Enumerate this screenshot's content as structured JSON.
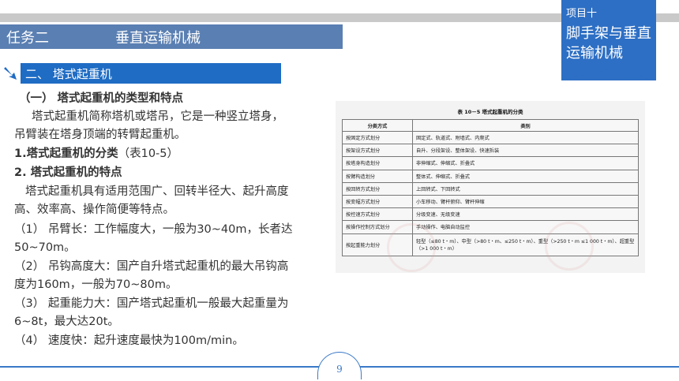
{
  "header": {
    "task": "任务二",
    "task_title": "垂直运输机械",
    "project_no": "项目十",
    "project_name": "脚手架与垂直运输机械"
  },
  "section": {
    "title": "二、 塔式起重机"
  },
  "body": {
    "heading1": "（一） 塔式起重机的类型和特点",
    "p1_line1": "塔式起重机简称塔机或塔吊，它是一种竖立塔身，",
    "p1_line2": "吊臂装在塔身顶端的转臂起重机。",
    "h_class": "1.塔式起重机的分类",
    "h_class_ref": "（表10-5）",
    "h_feat": "2. 塔式起重机的特点",
    "p2_line1": "塔式起重机具有适用范围广、回转半径大、起升高度",
    "p2_line2": "高、效率高、操作简便等特点。",
    "i1_line1": "（1） 吊臂长：工作幅度大，一般为30~40m，长者达",
    "i1_line2": "50~70m。",
    "i2_line1": "（2） 吊钩高度大：国产自升塔式起重机的最大吊钩高",
    "i2_line2": "度为160m，一般为70~80m。",
    "i3_line1": "（3） 起重能力大：国产塔式起重机一般最大起重量为",
    "i3_line2": "6~8t，最大达20t。",
    "i4_line1": "（4） 速度快：起升速度最快为100m/min。"
  },
  "table": {
    "caption": "表 10－5   塔式起重机的分类",
    "headers": [
      "分类方式",
      "类别"
    ],
    "rows": [
      [
        "按固定方式划分",
        "固定式、轨道式、附墙式、内爬式"
      ],
      [
        "按架设方式划分",
        "自升、分段架设、整体架设、快速拆装"
      ],
      [
        "按塔身构造划分",
        "非伸缩式、伸缩式、折叠式"
      ],
      [
        "按臂构造划分",
        "整体式、伸缩式、折叠式"
      ],
      [
        "按回转方式划分",
        "上回转式、下回转式"
      ],
      [
        "按变幅方式划分",
        "小车移动、臂杆俯仰、臂杆伸缩"
      ],
      [
        "按控速方式划分",
        "分级变速、无级变速"
      ],
      [
        "按操作控制方式划分",
        "手动操作、电脑自动监控"
      ],
      [
        "按起重能力划分",
        "轻型（≤80 t・m）、中型（>80 t・m、≤250 t・m）、重型（>250 t・m ≤1 000 t・m）、超重型（>1 000 t・m）"
      ]
    ]
  },
  "footer": {
    "page": "9"
  },
  "colors": {
    "title_bar": "#5a7fb2",
    "section_bar": "#1f6cc4",
    "badge": "#2d6fc4",
    "accent_line": "#3a79c8"
  }
}
